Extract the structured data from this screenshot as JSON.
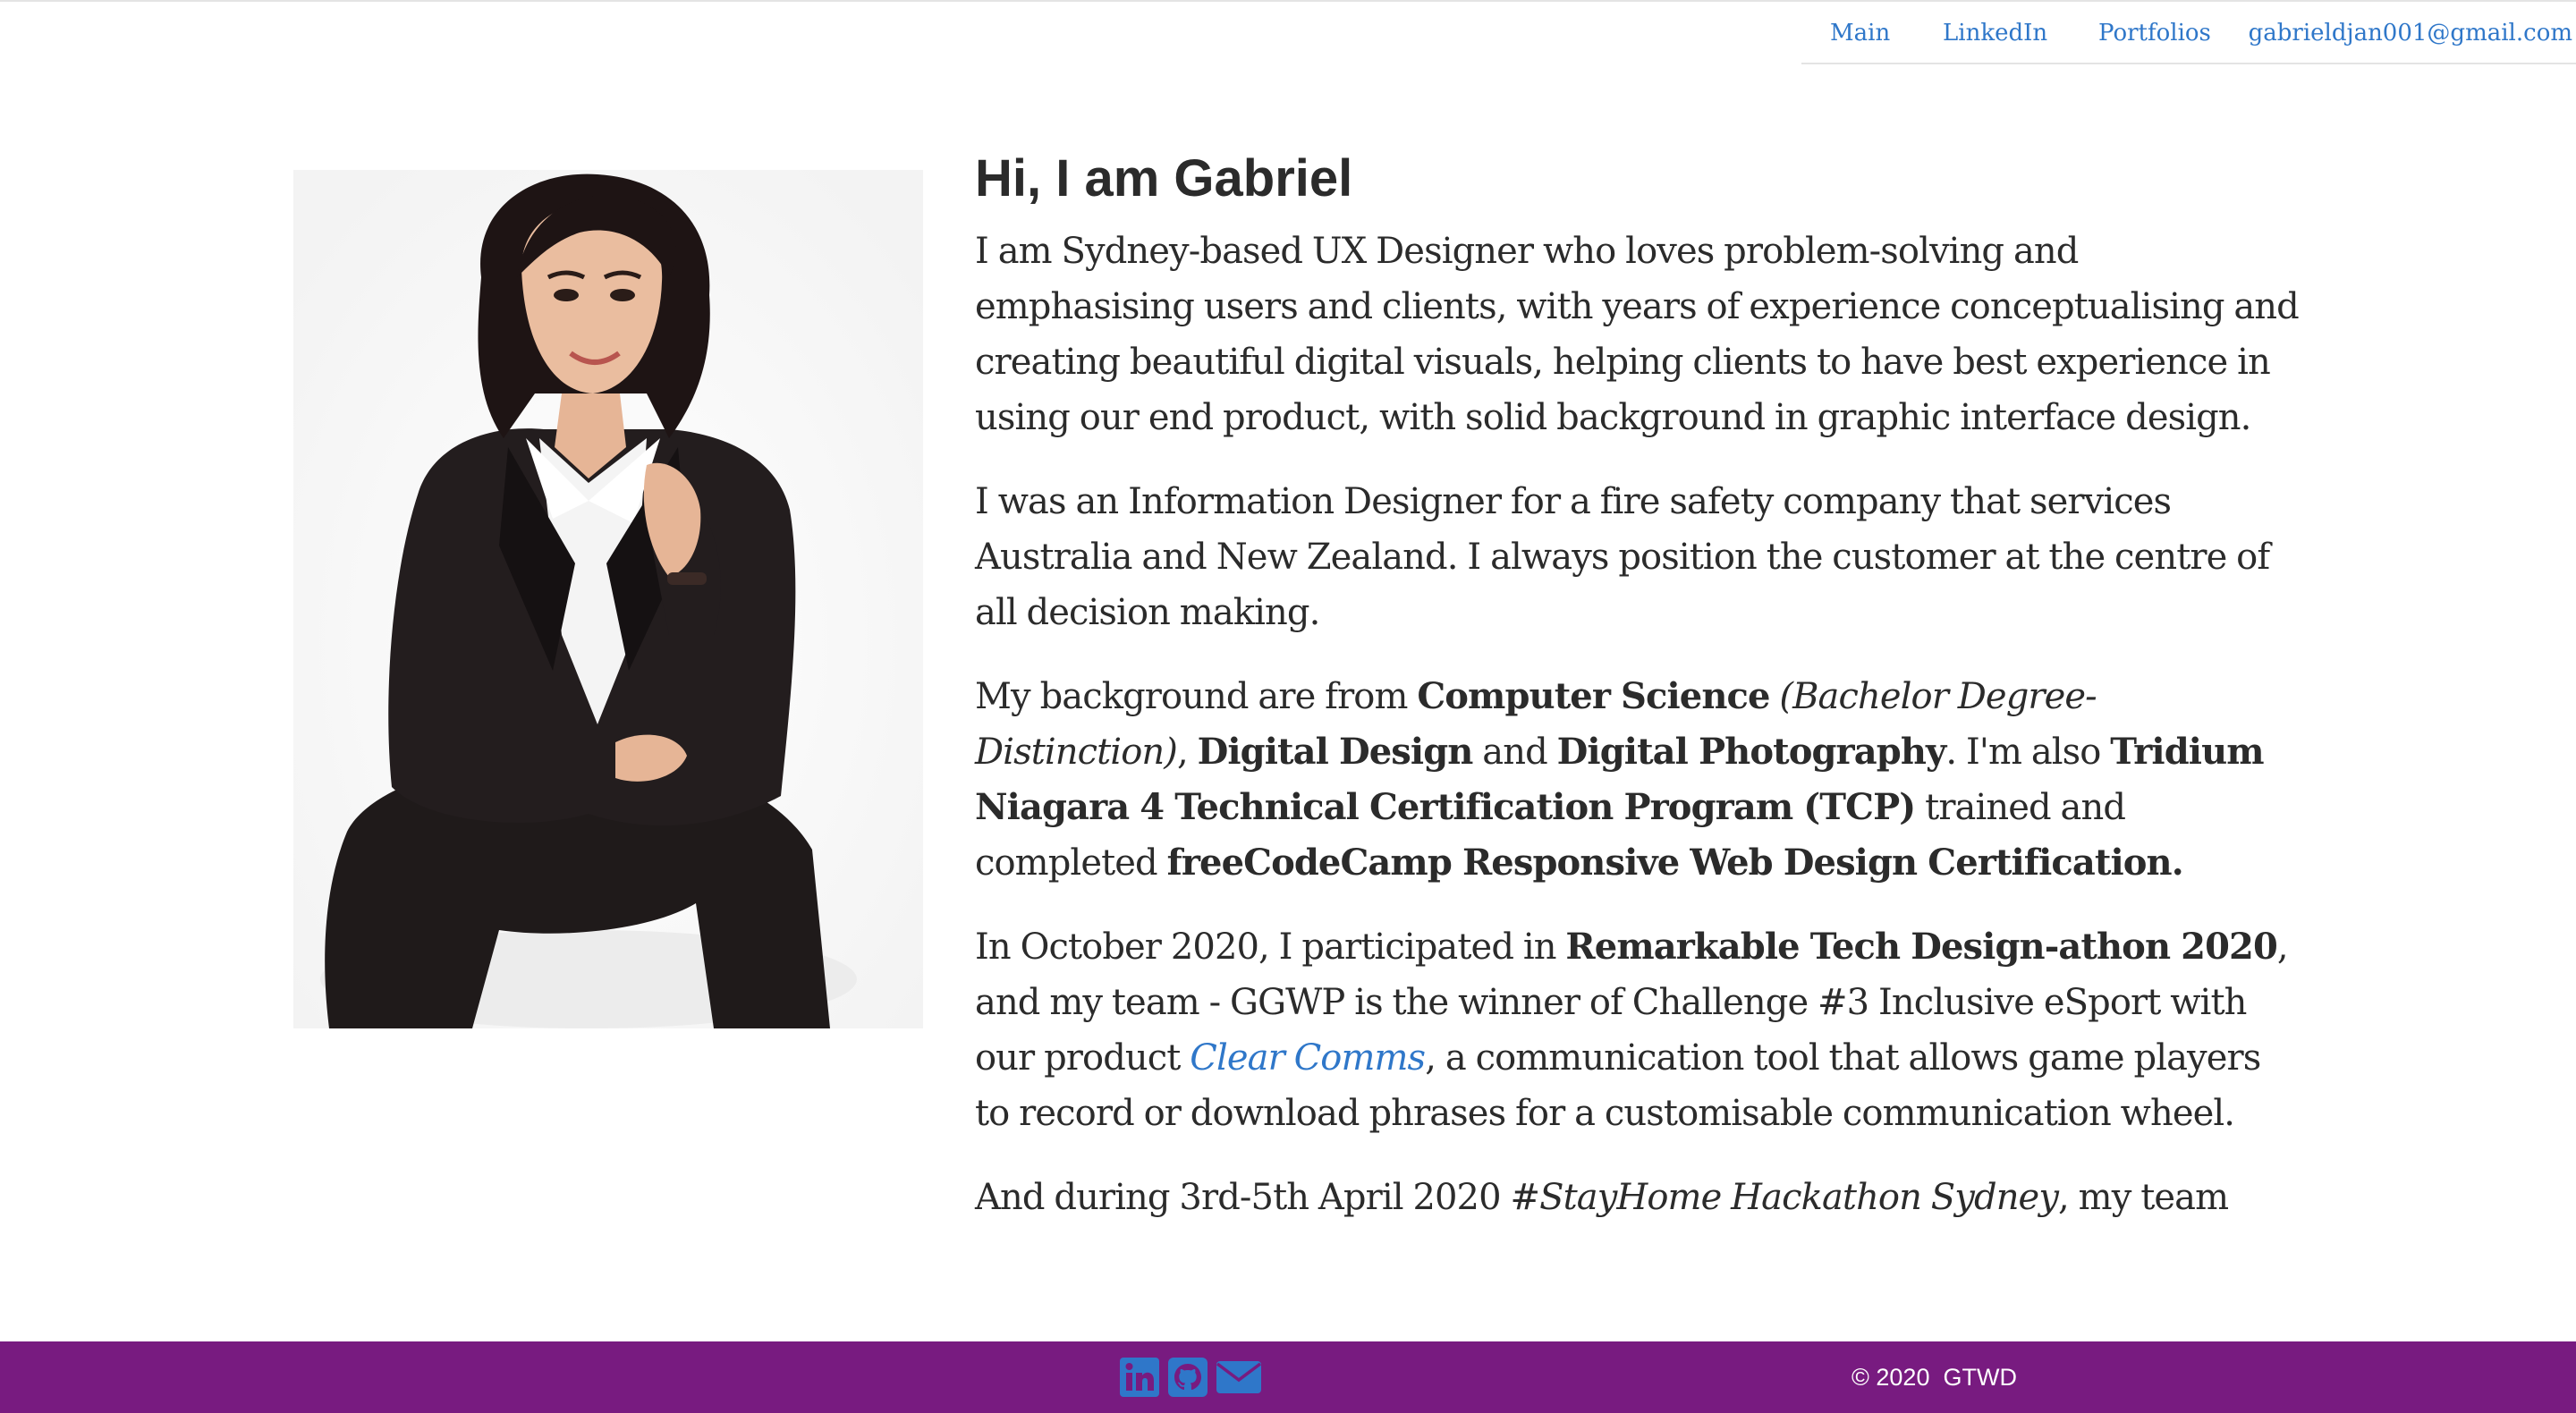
{
  "nav": {
    "main": "Main",
    "linkedin": "LinkedIn",
    "portfolios": "Portfolios",
    "email": "gabrieldjan001@gmail.com"
  },
  "hero": {
    "heading": "Hi, I am Gabriel",
    "portrait": "portrait photo of Gabriel"
  },
  "paragraphs": {
    "p1": "I am Sydney-based UX Designer who loves problem-solving and emphasising users and clients, with years of experience conceptualising and creating beautiful digital visuals, helping clients to have best experience in using our end product, with solid background in graphic interface design.",
    "p2": "I was an Information Designer for a fire safety company that services Australia and New Zealand. I always position the customer at the centre of all decision making.",
    "p3": {
      "t1": "My background are from ",
      "b1": "Computer Science",
      "t2": " ",
      "i1": "(Bachelor Degree- Distinction)",
      "t3": ", ",
      "b2": "Digital Design",
      "t4": " and ",
      "b3": "Digital Photography",
      "t5": ". I'm also ",
      "b4": "Tridium Niagara 4 Technical Certification Program (TCP)",
      "t6": " trained and completed ",
      "b5": "freeCodeCamp Responsive Web Design Certification."
    },
    "p4": {
      "t1": "In October 2020, I participated in ",
      "b1": "Remarkable Tech Design-athon 2020",
      "t2": ", and my team - GGWP is the winner of Challenge #3 Inclusive eSport with our product ",
      "link": "Clear Comms",
      "t3": ", a communication tool that allows game players to record or download phrases for a customisable communication wheel."
    },
    "p5": {
      "t1": "And during 3rd-5th April 2020 ",
      "i1": "#StayHome Hackathon Sydney",
      "t2": ", my team"
    }
  },
  "footer": {
    "icons": [
      "linkedin-icon",
      "github-icon",
      "mail-icon"
    ],
    "copyright": "© 2020  GTWD"
  },
  "colors": {
    "link": "#2f77c9",
    "footer_bg": "#781b80",
    "text": "#2b2b2b",
    "icon": "#2f77c9"
  }
}
